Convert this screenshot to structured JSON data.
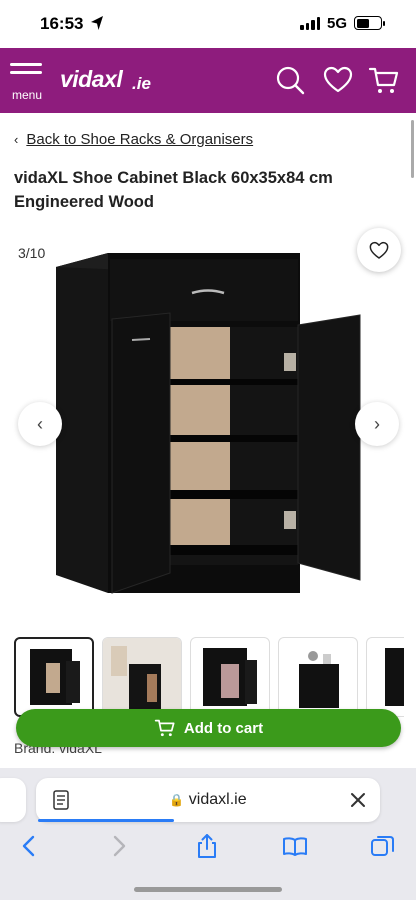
{
  "status_bar": {
    "time": "16:53",
    "network": "5G"
  },
  "header": {
    "menu_label": "menu",
    "logo_text": "vidaxl",
    "logo_suffix": ".ie",
    "brand_color": "#8e1c7d",
    "icons": [
      "search-icon",
      "heart-icon",
      "cart-icon"
    ]
  },
  "breadcrumb": {
    "back_label": "Back to Shoe Racks & Organisers"
  },
  "product": {
    "title": "vidaXL Shoe Cabinet Black 60x35x84 cm Engineered Wood",
    "image_counter": "3/10",
    "brand": "Brand: vidaXL"
  },
  "thumbnails": {
    "count_visible": 5,
    "active_index": 0
  },
  "cart": {
    "button_label": "Add to cart",
    "button_color": "#3b9a1b"
  },
  "safari": {
    "url": "vidaxl.ie",
    "accent_color": "#2a7cf6",
    "toolbar_icons": [
      "back-icon",
      "forward-icon",
      "share-icon",
      "bookmarks-icon",
      "tabs-icon"
    ]
  }
}
